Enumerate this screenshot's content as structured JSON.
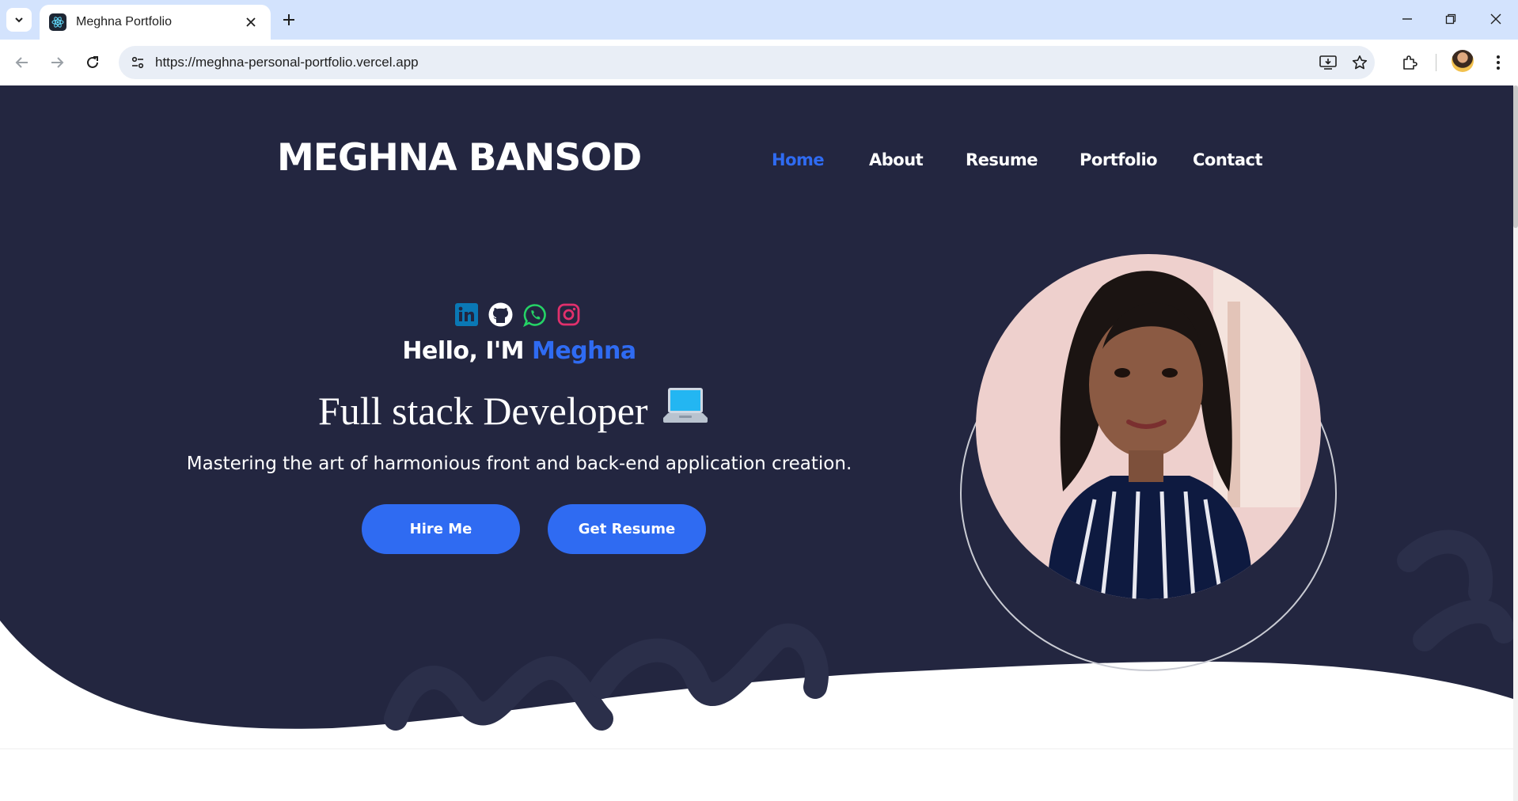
{
  "browser": {
    "tab_title": "Meghna Portfolio",
    "url": "https://meghna-personal-portfolio.vercel.app"
  },
  "site": {
    "brand": "MEGHNA BANSOD",
    "nav": [
      {
        "label": "Home",
        "active": true
      },
      {
        "label": "About",
        "active": false
      },
      {
        "label": "Resume",
        "active": false
      },
      {
        "label": "Portfolio",
        "active": false
      },
      {
        "label": "Contact",
        "active": false
      }
    ],
    "hero": {
      "socials": [
        "linkedin-icon",
        "github-icon",
        "whatsapp-icon",
        "instagram-icon"
      ],
      "greeting": "Hello, I'M",
      "name": "Meghna",
      "role": "Full stack Developer",
      "role_emoji": "laptop-icon",
      "tagline": "Mastering the art of harmonious front and back-end application creation.",
      "hire_label": "Hire Me",
      "resume_label": "Get Resume"
    }
  },
  "colors": {
    "hero_bg": "#232640",
    "accent": "#2f6bf2",
    "chrome_tabstrip": "#d3e3fd",
    "omnibox": "#e9eef6"
  }
}
